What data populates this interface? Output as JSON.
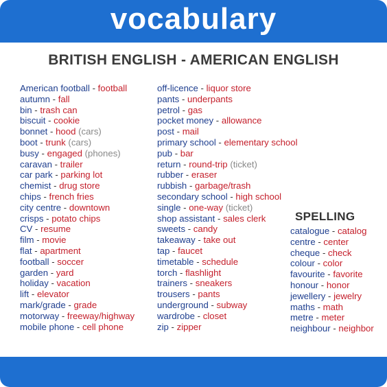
{
  "title": "vocabulary",
  "subtitle": "BRITISH ENGLISH - AMERICAN ENGLISH",
  "separator": "-",
  "column1": [
    {
      "british": "American football",
      "american": "football",
      "note": ""
    },
    {
      "british": "autumn",
      "american": "fall",
      "note": ""
    },
    {
      "british": "bin",
      "american": "trash can",
      "note": ""
    },
    {
      "british": "biscuit",
      "american": "cookie",
      "note": ""
    },
    {
      "british": "bonnet",
      "american": "hood",
      "note": "(cars)"
    },
    {
      "british": "boot",
      "american": "trunk",
      "note": "(cars)"
    },
    {
      "british": "busy",
      "american": "engaged",
      "note": "(phones)"
    },
    {
      "british": "caravan",
      "american": "trailer",
      "note": ""
    },
    {
      "british": "car park",
      "american": "parking lot",
      "note": ""
    },
    {
      "british": "chemist",
      "american": "drug store",
      "note": ""
    },
    {
      "british": "chips",
      "american": "french fries",
      "note": ""
    },
    {
      "british": "city centre",
      "american": "downtown",
      "note": ""
    },
    {
      "british": "crisps",
      "american": "potato chips",
      "note": ""
    },
    {
      "british": "CV",
      "american": "resume",
      "note": ""
    },
    {
      "british": "film",
      "american": "movie",
      "note": ""
    },
    {
      "british": "flat",
      "american": "apartment",
      "note": ""
    },
    {
      "british": "football",
      "american": "soccer",
      "note": ""
    },
    {
      "british": "garden",
      "american": "yard",
      "note": ""
    },
    {
      "british": "holiday",
      "american": "vacation",
      "note": ""
    },
    {
      "british": "lift",
      "american": "elevator",
      "note": ""
    },
    {
      "british": "mark/grade",
      "american": "grade",
      "note": ""
    },
    {
      "british": "motorway",
      "american": "freeway/highway",
      "note": ""
    },
    {
      "british": "mobile phone",
      "american": "cell phone",
      "note": ""
    }
  ],
  "column2": [
    {
      "british": "off-licence",
      "american": "liquor store",
      "note": ""
    },
    {
      "british": "pants",
      "american": "underpants",
      "note": ""
    },
    {
      "british": "petrol",
      "american": "gas",
      "note": ""
    },
    {
      "british": "pocket money",
      "american": "allowance",
      "note": ""
    },
    {
      "british": "post",
      "american": "mail",
      "note": ""
    },
    {
      "british": "primary school",
      "american": "elementary school",
      "note": ""
    },
    {
      "british": "pub",
      "american": "bar",
      "note": ""
    },
    {
      "british": "return",
      "american": "round-trip",
      "note": "(ticket)"
    },
    {
      "british": "rubber",
      "american": "eraser",
      "note": ""
    },
    {
      "british": "rubbish",
      "american": "garbage/trash",
      "note": ""
    },
    {
      "british": "secondary school",
      "american": "high school",
      "note": ""
    },
    {
      "british": "single",
      "american": "one-way",
      "note": "(ticket)"
    },
    {
      "british": "shop assistant",
      "american": "sales clerk",
      "note": ""
    },
    {
      "british": "sweets",
      "american": "candy",
      "note": ""
    },
    {
      "british": "takeaway",
      "american": "take out",
      "note": ""
    },
    {
      "british": "tap",
      "american": "faucet",
      "note": ""
    },
    {
      "british": "timetable",
      "american": "schedule",
      "note": ""
    },
    {
      "british": "torch",
      "american": "flashlight",
      "note": ""
    },
    {
      "british": "trainers",
      "american": "sneakers",
      "note": ""
    },
    {
      "british": "trousers",
      "american": "pants",
      "note": ""
    },
    {
      "british": "underground",
      "american": "subway",
      "note": ""
    },
    {
      "british": "wardrobe",
      "american": "closet",
      "note": ""
    },
    {
      "british": "zip",
      "american": "zipper",
      "note": ""
    }
  ],
  "spelling": {
    "title": "SPELLING",
    "items": [
      {
        "british": "catalogue",
        "american": "catalog",
        "note": ""
      },
      {
        "british": "centre",
        "american": "center",
        "note": ""
      },
      {
        "british": "cheque",
        "american": "check",
        "note": ""
      },
      {
        "british": "colour",
        "american": "color",
        "note": ""
      },
      {
        "british": "favourite",
        "american": "favorite",
        "note": ""
      },
      {
        "british": "honour",
        "american": "honor",
        "note": ""
      },
      {
        "british": "jewellery",
        "american": "jewelry",
        "note": ""
      },
      {
        "british": "maths",
        "american": "math",
        "note": ""
      },
      {
        "british": "metre",
        "american": "meter",
        "note": ""
      },
      {
        "british": "neighbour",
        "american": "neighbor",
        "note": ""
      }
    ]
  },
  "colors": {
    "brand_blue": "#1e6fd0",
    "british_text": "#1f3f8f",
    "american_text": "#c41e2a",
    "note_text": "#888888"
  }
}
